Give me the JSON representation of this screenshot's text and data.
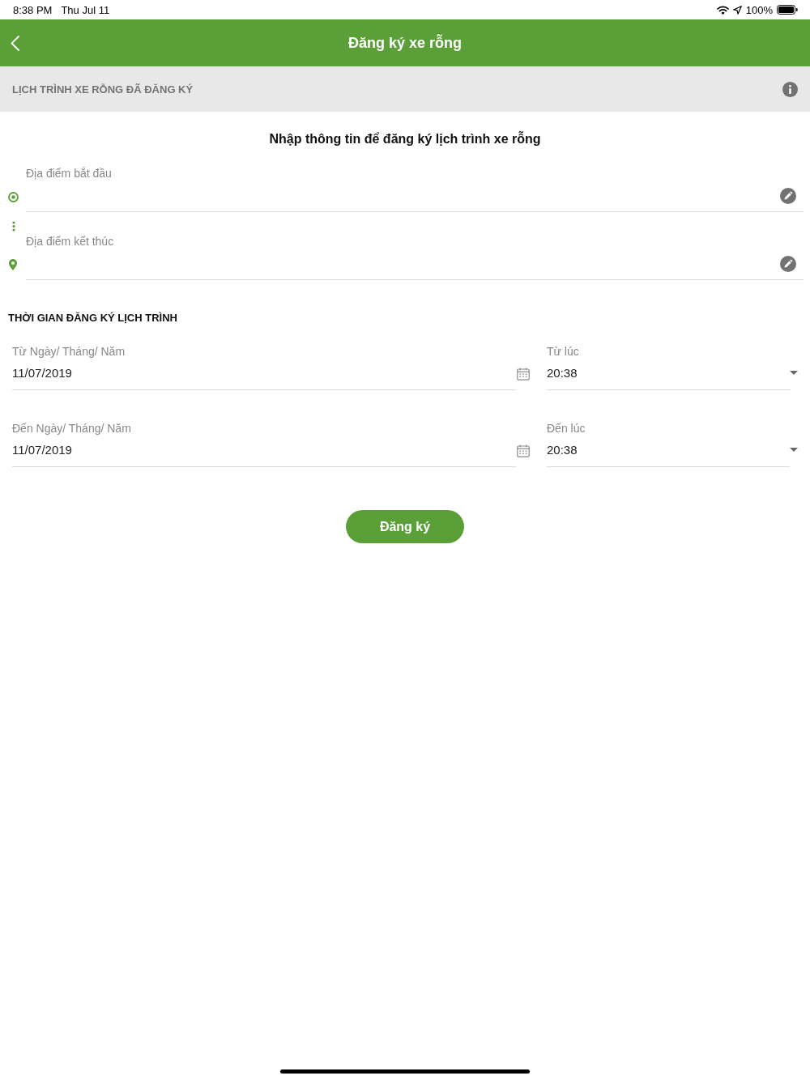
{
  "status_bar": {
    "time": "8:38 PM",
    "date": "Thu Jul 11",
    "battery": "100%"
  },
  "nav_bar": {
    "title": "Đăng ký xe rỗng"
  },
  "registered_banner": {
    "label": "LỊCH TRÌNH XE RỖNG ĐÃ ĐĂNG KÝ"
  },
  "form": {
    "heading": "Nhập thông tin để đăng ký lịch trình xe rỗng",
    "locations": [
      {
        "kind": "start",
        "label": "Địa điểm bắt đầu"
      },
      {
        "kind": "end",
        "label": "Địa điểm kết thúc"
      }
    ],
    "time_section": {
      "title": "THỜI GIAN ĐĂNG KÝ LỊCH TRÌNH",
      "rows": [
        {
          "date": {
            "label": "Từ Ngày/ Tháng/ Năm",
            "value": "11/07/2019"
          },
          "time": {
            "label": "Từ lúc",
            "value": "20:38"
          }
        },
        {
          "date": {
            "label": "Đến Ngày/ Tháng/ Năm",
            "value": "11/07/2019"
          },
          "time": {
            "label": "Đến lúc",
            "value": "20:38"
          }
        }
      ]
    },
    "submit_button": "Đăng ký"
  }
}
